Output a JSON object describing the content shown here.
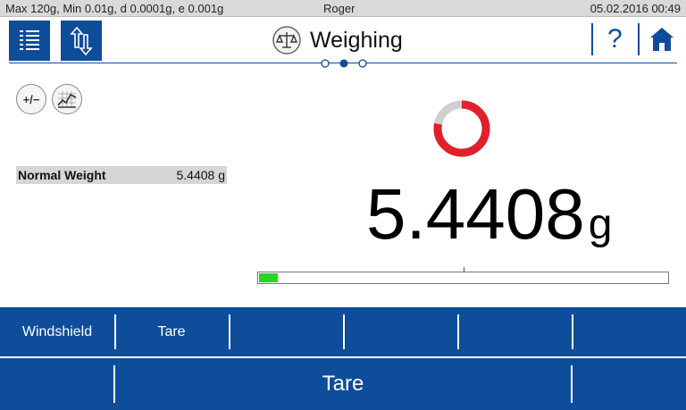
{
  "status": {
    "capacity": "Max 120g, Min 0.01g, d 0.0001g, e 0.001g",
    "user": "Roger",
    "datetime": "05.02.2016 00:49"
  },
  "header": {
    "title": "Weighing",
    "help_label": "?",
    "menu_icon": "list-icon",
    "updown_icon": "up-down-arrows-icon",
    "title_icon": "balance-scale-icon",
    "home_icon": "home-icon",
    "page_dots": 3,
    "active_dot": 2
  },
  "tools": {
    "sign_label": "+/−",
    "stats_icon": "statistics-icon"
  },
  "info": {
    "label": "Normal Weight",
    "value": "5.4408 g"
  },
  "reading": {
    "value": "5.4408",
    "unit": "g",
    "stability_fraction": 0.78,
    "capacity_fraction": 0.045
  },
  "softkeys": [
    "Windshield",
    "Tare",
    "",
    "",
    "",
    ""
  ],
  "main_key": {
    "label": "Tare"
  },
  "colors": {
    "brand_blue": "#0d4d9a",
    "ring_red": "#e0202a",
    "ring_gray": "#cfcfcf",
    "capacity_green": "#22d822"
  }
}
